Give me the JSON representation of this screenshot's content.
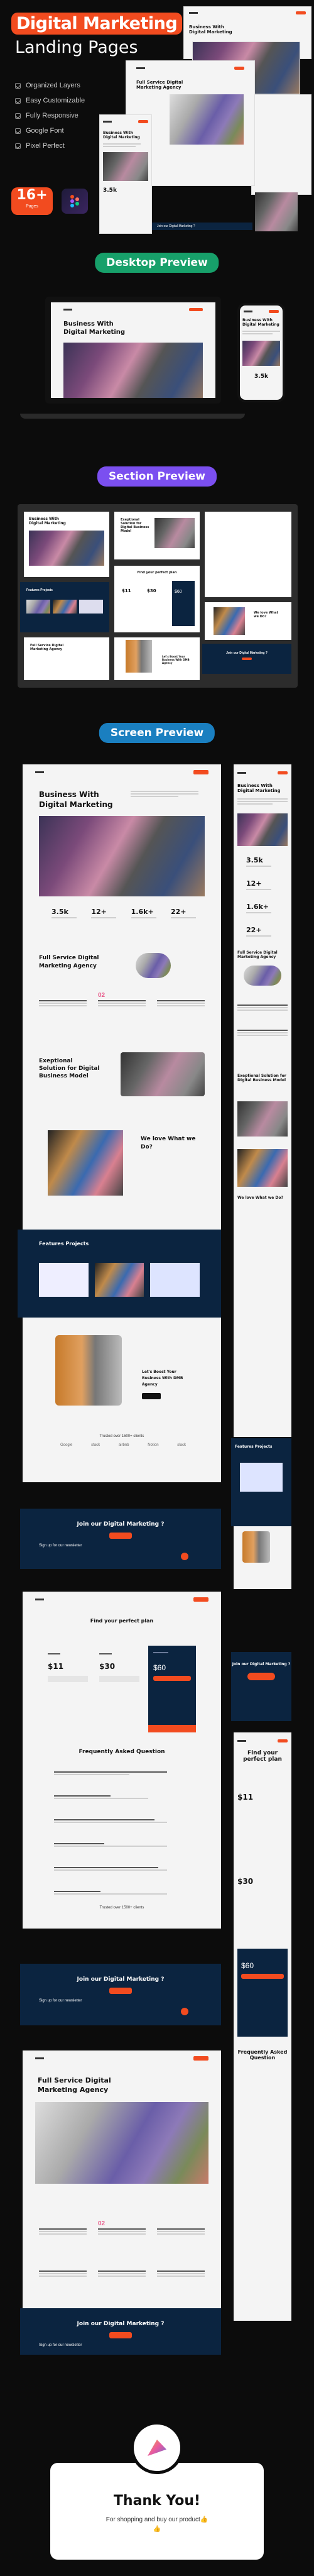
{
  "hero": {
    "title": "Digital Marketing",
    "subtitle": "Landing Pages",
    "features": [
      "Organized Layers",
      "Easy Customizable",
      "Fully Responsive",
      "Google Font",
      "Pixel Perfect"
    ],
    "badge_count": "16+",
    "badge_label": "Pages",
    "brand_color": "#f24b1f"
  },
  "mockups": {
    "back_heading": "Business With Digital Marketing",
    "mid_heading": "Full Service Digital Marketing Agency",
    "front_heading": "Business With Digital Marketing",
    "front_stat": "3.5k",
    "cta_strip": "Join our Digital Marketing ?"
  },
  "sections": {
    "desktop_label": "Desktop Preview",
    "desktop_color": "#17a06a",
    "section_label": "Section Preview",
    "section_color": "#7b4ff0",
    "screen_label": "Screen Preview",
    "screen_color": "#1a7fc0"
  },
  "desktop_preview": {
    "heading": "Business With Digital Marketing",
    "mobile_heading": "Business With Digital Marketing",
    "mobile_stat": "3.5k"
  },
  "section_preview": {
    "hero_heading": "Business With Digital Marketing",
    "solution_heading": "Exeptional Solution for Digital Business Model",
    "pricing_heading": "Find your perfect plan",
    "prices": [
      "$11",
      "$30",
      "$60"
    ],
    "projects_heading": "Features Projects",
    "agency_heading": "Full Service Digital Marketing Agency",
    "boost_heading": "Let's Boost Your Business With DMB Agency",
    "love_heading": "We love What we Do?",
    "cta_heading": "Join our Digital Marketing ?"
  },
  "screen1": {
    "hero_heading_1": "Business With",
    "hero_heading_2": "Digital Marketing",
    "stats": [
      {
        "value": "3.5k"
      },
      {
        "value": "12+"
      },
      {
        "value": "1.6k+"
      },
      {
        "value": "22+"
      }
    ],
    "agency_heading_1": "Full Service Digital",
    "agency_heading_2": "Marketing Agency",
    "service_number": "02",
    "solution_heading_1": "Exeptional",
    "solution_heading_2": "Solution for Digital",
    "solution_heading_3": "Business Model",
    "love_heading_1": "We love What we",
    "love_heading_2": "Do?",
    "projects_heading": "Features Projects",
    "boost_heading_1": "Let's Boost Your",
    "boost_heading_2": "Business With DMB",
    "boost_heading_3": "Agency",
    "trusted": "Trusted over 1500+ clients",
    "logos": [
      "Google",
      "stack",
      "airbnb",
      "Notion",
      "slack"
    ],
    "cta_heading": "Join our Digital Marketing ?",
    "newsletter": "Sign up for our newsletter"
  },
  "screen2": {
    "pricing_heading": "Find your perfect plan",
    "plans": [
      {
        "price": "$11"
      },
      {
        "price": "$30"
      },
      {
        "price": "$60"
      }
    ],
    "faq_heading": "Frequently Asked Question",
    "faq_count": 6,
    "trusted": "Trusted over 1500+ clients",
    "cta_heading": "Join our Digital Marketing ?",
    "newsletter": "Sign up for our newsletter"
  },
  "screen3": {
    "heading_1": "Full Service Digital",
    "heading_2": "Marketing Agency",
    "service_number": "02",
    "cta_heading": "Join our Digital Marketing ?",
    "newsletter": "Sign up for our newsletter"
  },
  "mobile": {
    "hero_heading": "Business With Digital Marketing",
    "stats": [
      "3.5k",
      "12+",
      "1.6k+",
      "22+"
    ],
    "agency_heading": "Full Service Digital Marketing Agency",
    "solution_heading": "Exeptional Solution for Digital Business Model",
    "love_heading": "We love What we Do?",
    "projects_heading": "Features Projects",
    "cta_heading": "Join our Digital Marketing ?",
    "pricing_heading": "Find your perfect plan",
    "prices": [
      "$11",
      "$30",
      "$60"
    ],
    "faq_heading": "Frequently Asked Question"
  },
  "thanks": {
    "title": "Thank You!",
    "message": "For shopping and buy our product👍👍"
  }
}
